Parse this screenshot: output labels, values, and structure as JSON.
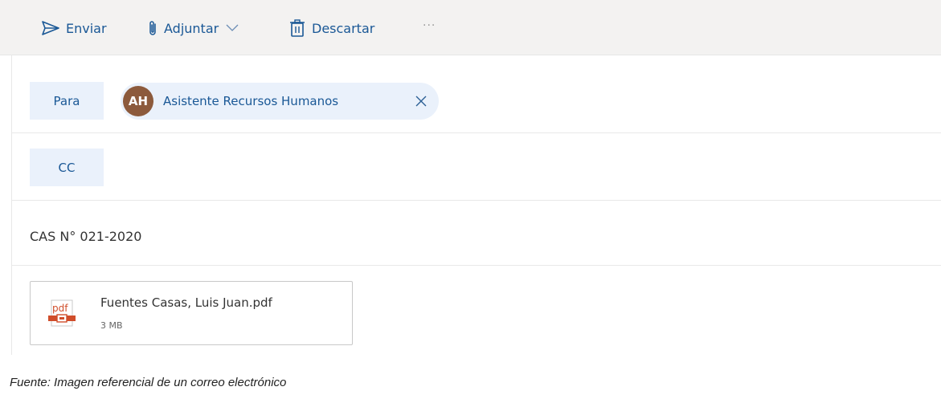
{
  "toolbar": {
    "send_label": "Enviar",
    "attach_label": "Adjuntar",
    "discard_label": "Descartar",
    "more_label": "···"
  },
  "to": {
    "label": "Para",
    "recipient": {
      "initials": "AH",
      "name": "Asistente Recursos Humanos",
      "avatar_color": "#8c5a3c"
    }
  },
  "cc": {
    "label": "CC"
  },
  "subject": "CAS N° 021-2020",
  "attachment": {
    "icon": "pdf-icon",
    "icon_text": "pdf",
    "name": "Fuentes Casas, Luis Juan.pdf",
    "size": "3 MB"
  },
  "caption": "Fuente: Imagen referencial de un correo electrónico",
  "colors": {
    "accent": "#1a5896",
    "chip_bg": "#eaf1fb",
    "pdf": "#d04d2a"
  }
}
